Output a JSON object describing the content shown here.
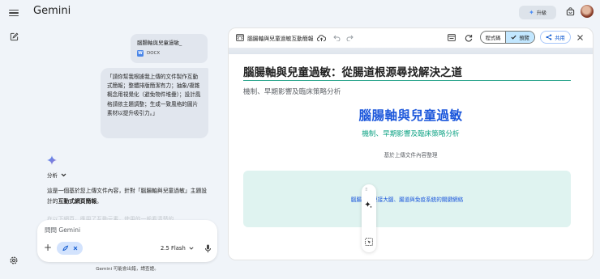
{
  "app": {
    "title": "Gemini",
    "upgrade_label": "升級"
  },
  "chat": {
    "file": {
      "name": "腦腸軸與兒童過敏_",
      "type": "DOCX"
    },
    "user_message": "「請你幫我根據我上傳的文件製作互動式簡報；整體排版簡潔有力；抽象/複雜概念用視覺化（避免物件堆疊）；設計風格請依主題調整；生成一致風格的圖片素材以提升吸引力。」",
    "analysis_label": "分析",
    "reply_prefix": "這是一個基於您上傳文件內容，針對「腦腸軸與兒童過敏」主題設計的",
    "reply_bold": "互動式網頁簡報",
    "reply_suffix": "。",
    "reply_faded": "在以下網頁，應用了互動元素，使用的一般看清楚的..."
  },
  "composer": {
    "placeholder": "問問 Gemini",
    "model": "2.5 Flash"
  },
  "disclaimer": "Gemini 可能會出錯，請查證。",
  "canvas": {
    "doc_title": "腦腸軸與兒童過敏互動簡報",
    "tab_code": "程式碼",
    "tab_preview": "預覽",
    "share_label": "共用",
    "page": {
      "h1": "腦腸軸與兒童過敏：從腸道根源尋找解決之道",
      "h1_sub": "機制、早期影響及臨床策略分析",
      "hero_title": "腦腸軸與兒童過敏",
      "hero_sub": "機制、早期影響及臨床策略分析",
      "hero_note": "基於上傳文件內容整理",
      "card_text": "腦腸軸：連接大腦、腸道與免疫系統的關鍵網絡"
    }
  },
  "colors": {
    "accent_blue": "#1a56db",
    "teal": "#12a486",
    "preview_tab_bg": "#c2e7ff"
  }
}
